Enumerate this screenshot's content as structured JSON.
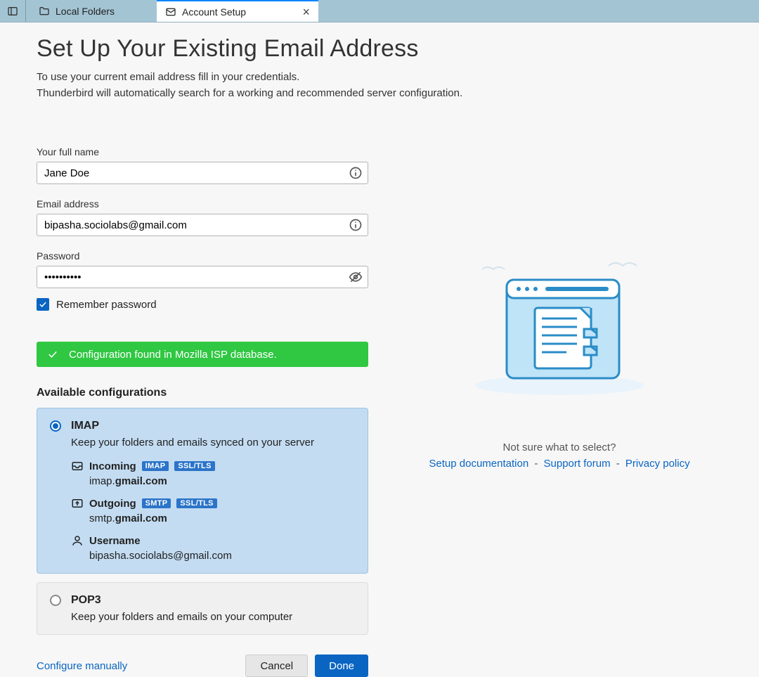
{
  "tabs": {
    "local_folders": "Local Folders",
    "account_setup": "Account Setup"
  },
  "heading": "Set Up Your Existing Email Address",
  "sub1": "To use your current email address fill in your credentials.",
  "sub2": "Thunderbird will automatically search for a working and recommended server configuration.",
  "form": {
    "name_label": "Your full name",
    "name_value": "Jane Doe",
    "email_label": "Email address",
    "email_value": "bipasha.sociolabs@gmail.com",
    "pw_label": "Password",
    "pw_value": "••••••••••",
    "remember_label": "Remember password"
  },
  "status_msg": "Configuration found in Mozilla ISP database.",
  "avail_title": "Available configurations",
  "imap": {
    "title": "IMAP",
    "desc": "Keep your folders and emails synced on your server",
    "incoming_label": "Incoming",
    "incoming_proto": "IMAP",
    "incoming_sec": "SSL/TLS",
    "incoming_host_pre": "imap.",
    "incoming_host_bold": "gmail.com",
    "outgoing_label": "Outgoing",
    "outgoing_proto": "SMTP",
    "outgoing_sec": "SSL/TLS",
    "outgoing_host_pre": "smtp.",
    "outgoing_host_bold": "gmail.com",
    "user_label": "Username",
    "user_value": "bipasha.sociolabs@gmail.com"
  },
  "pop3": {
    "title": "POP3",
    "desc": "Keep your folders and emails on your computer"
  },
  "cfg_manual": "Configure manually",
  "btn_cancel": "Cancel",
  "btn_done": "Done",
  "right": {
    "helper": "Not sure what to select?",
    "link1": "Setup documentation",
    "link2": "Support forum",
    "link3": "Privacy policy",
    "sep": "-"
  }
}
